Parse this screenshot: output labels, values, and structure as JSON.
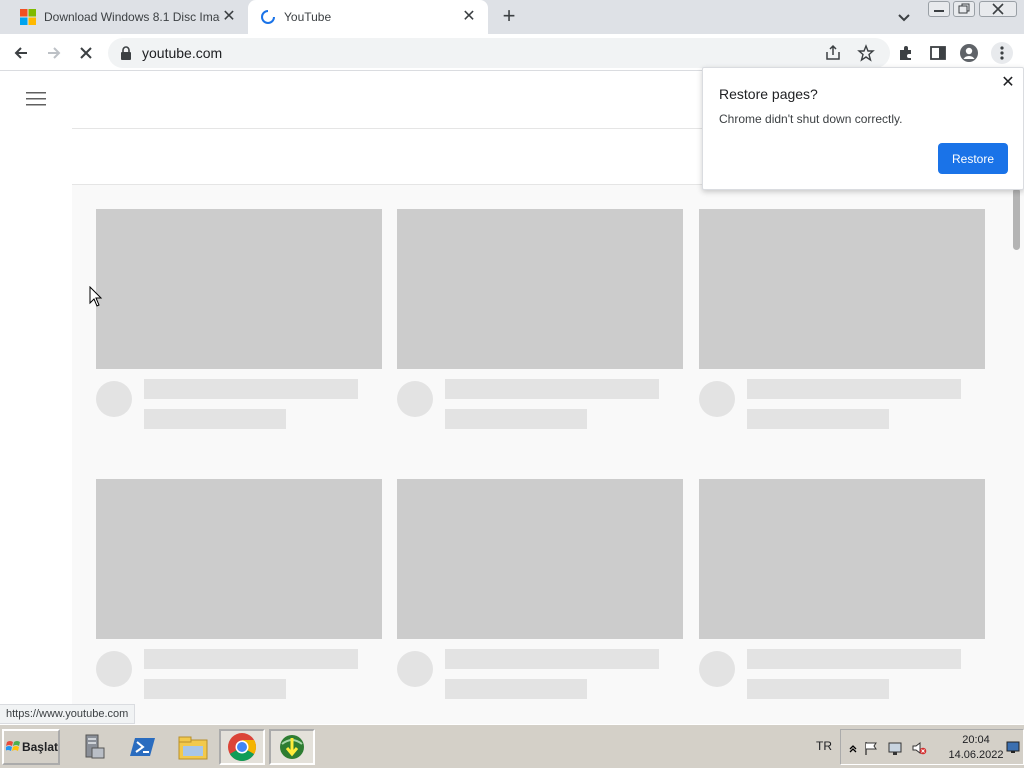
{
  "tabs": [
    {
      "title": "Download Windows 8.1 Disc Image",
      "favicon": "windows-logo-icon",
      "active": false
    },
    {
      "title": "YouTube",
      "favicon": "loading-spinner-icon",
      "active": true
    }
  ],
  "new_tab_icon": "plus-icon",
  "toolbar": {
    "url": "youtube.com",
    "icons": [
      "back-icon",
      "forward-icon",
      "stop-icon",
      "lock-icon",
      "share-icon",
      "star-icon",
      "extensions-icon",
      "side-panel-icon",
      "profile-icon",
      "more-icon"
    ]
  },
  "restore_bubble": {
    "title": "Restore pages?",
    "message": "Chrome didn't shut down correctly.",
    "button": "Restore"
  },
  "status_link": "https://www.youtube.com",
  "taskbar": {
    "start_label": "Başlat",
    "language": "TR",
    "time": "20:04",
    "date": "14.06.2022",
    "apps": [
      "server-manager-icon",
      "powershell-icon",
      "file-explorer-icon",
      "chrome-icon",
      "internet-download-manager-icon"
    ]
  },
  "colors": {
    "accent": "#1a73e8",
    "tabstrip": "#dee1e6",
    "placeholder": "#cccccc",
    "taskbar": "#d4d0c8"
  }
}
